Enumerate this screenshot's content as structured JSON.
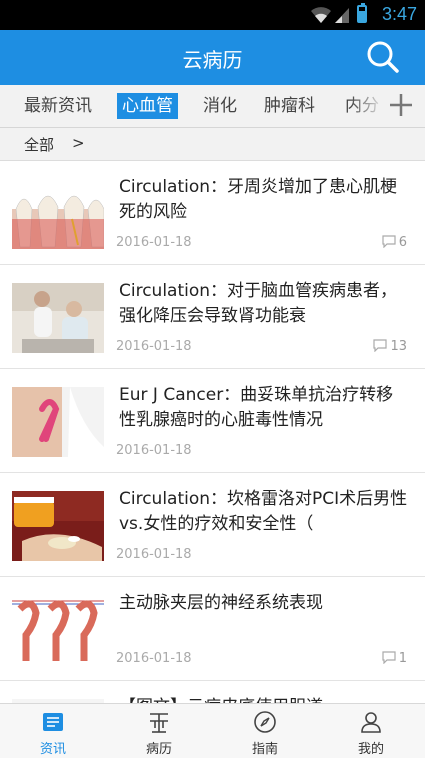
{
  "status": {
    "time": "3:47"
  },
  "header": {
    "title": "云病历"
  },
  "tabs": [
    {
      "label": "最新资讯"
    },
    {
      "label": "心血管"
    },
    {
      "label": "消化"
    },
    {
      "label": "肿瘤科"
    },
    {
      "label": "内分"
    }
  ],
  "filter": {
    "label": "全部",
    "arrow": ">"
  },
  "articles": [
    {
      "title": "Circulation：牙周炎增加了患心肌梗死的风险",
      "date": "2016-01-18",
      "comments": "6"
    },
    {
      "title": "Circulation：对于脑血管疾病患者，强化降压会导致肾功能衰",
      "date": "2016-01-18",
      "comments": "13"
    },
    {
      "title": "Eur J Cancer：曲妥珠单抗治疗转移性乳腺癌时的心脏毒性情况",
      "date": "2016-01-18",
      "comments": ""
    },
    {
      "title": "Circulation：坎格雷洛对PCI术后男性vs.女性的疗效和安全性（",
      "date": "2016-01-18",
      "comments": ""
    },
    {
      "title": "主动脉夹层的神经系统表现",
      "date": "2016-01-18",
      "comments": "1"
    },
    {
      "title": "【图文】云病皮底使用胆道",
      "date": "",
      "comments": ""
    }
  ],
  "bottom_nav": [
    {
      "label": "资讯",
      "icon": "news-icon"
    },
    {
      "label": "病历",
      "icon": "record-icon"
    },
    {
      "label": "指南",
      "icon": "compass-icon"
    },
    {
      "label": "我的",
      "icon": "person-icon"
    }
  ],
  "colors": {
    "primary": "#1e8ee2",
    "statusbar": "#000000",
    "status_accent": "#3aa7e0"
  }
}
